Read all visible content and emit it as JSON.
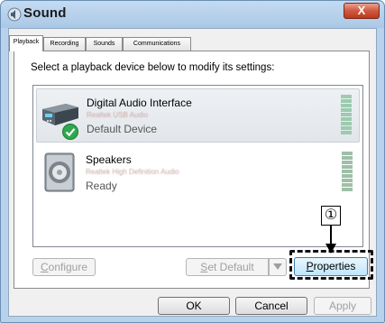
{
  "window": {
    "title": "Sound",
    "close_glyph": "X"
  },
  "tabs": [
    {
      "label": "Playback",
      "active": true
    },
    {
      "label": "Recording",
      "active": false
    },
    {
      "label": "Sounds",
      "active": false
    },
    {
      "label": "Communications",
      "active": false
    }
  ],
  "instruction": "Select a playback device below to modify its settings:",
  "devices": [
    {
      "name": "Digital Audio Interface",
      "subtitle": "Realtek USB Audio",
      "status": "Default Device",
      "icon": "digital-interface-icon",
      "default_badge": "checkmark-icon"
    },
    {
      "name": "Speakers",
      "subtitle": "Realtek High Definition Audio",
      "status": "Ready",
      "icon": "speaker-icon"
    }
  ],
  "buttons": {
    "configure": {
      "prefix": "",
      "mnemonic": "C",
      "rest": "onfigure",
      "enabled": false
    },
    "set_default": {
      "prefix": "",
      "mnemonic": "S",
      "rest": "et Default",
      "enabled": false
    },
    "properties": {
      "prefix": "",
      "mnemonic": "P",
      "rest": "roperties",
      "enabled": true
    },
    "ok": "OK",
    "cancel": "Cancel",
    "apply": "Apply"
  },
  "callout": {
    "number": "①"
  },
  "colors": {
    "accent_frame": "#aac8e6",
    "close_button": "#d0593f",
    "default_check": "#2fa84f"
  }
}
